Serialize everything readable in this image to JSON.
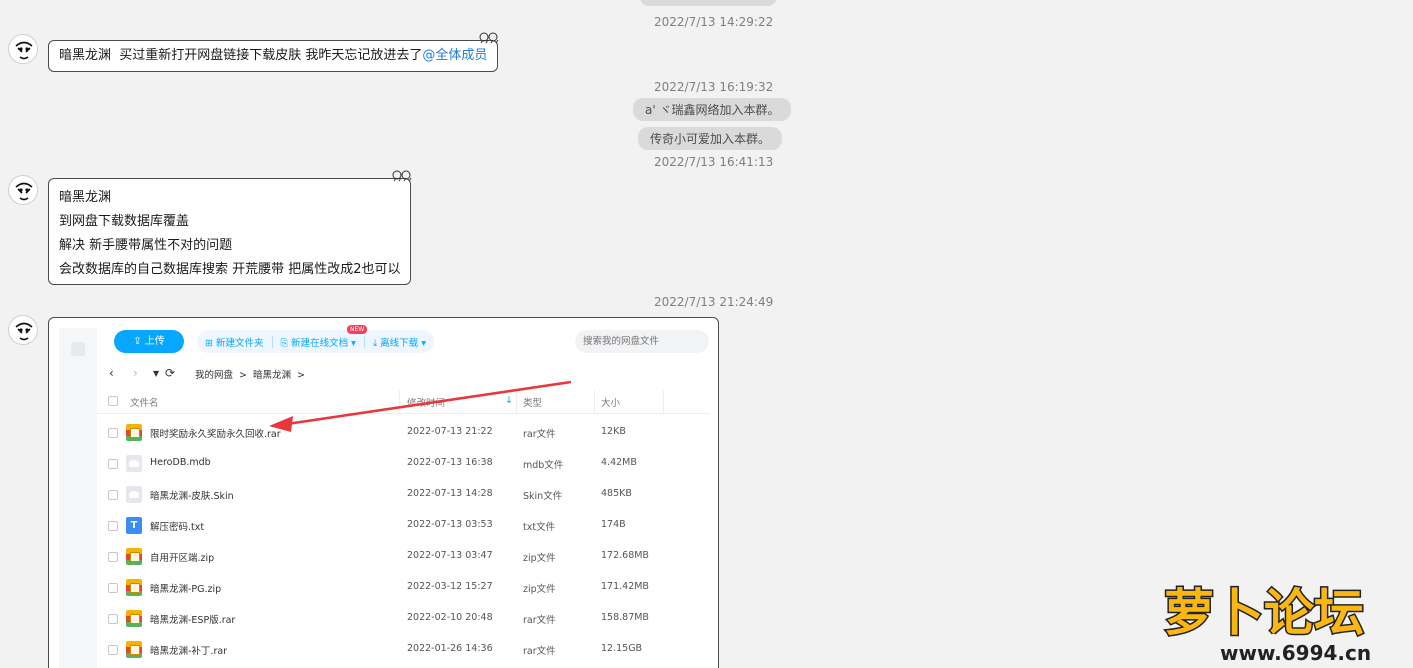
{
  "messages": {
    "top_pill": "...",
    "ts1": "2022/7/13 14:29:22",
    "msg1": {
      "sender": "暗黑龙渊",
      "text": "买过重新打开网盘链接下载皮肤 我昨天忘记放进去了",
      "mention": "@全体成员"
    },
    "ts2": "2022/7/13 16:19:32",
    "sys1": "a' ヾ瑞鑫网络加入本群。",
    "sys2": "传奇小可爱加入本群。",
    "ts3": "2022/7/13 16:41:13",
    "msg2": {
      "sender": "暗黑龙渊",
      "lines": [
        "到网盘下载数据库覆盖",
        "解决 新手腰带属性不对的问题",
        "会改数据库的自己数据库搜索 开荒腰带 把属性改成2也可以"
      ]
    },
    "ts4": "2022/7/13 21:24:49"
  },
  "netdisk": {
    "upload": "上传",
    "new_folder": "新建文件夹",
    "new_online_doc": "新建在线文档",
    "new_badge": "NEW",
    "offline_download": "离线下载",
    "search_placeholder": "搜索我的网盘文件",
    "breadcrumb": [
      "我的网盘",
      ">",
      "暗黑龙渊",
      ">"
    ],
    "columns": {
      "name": "文件名",
      "modified": "修改时间",
      "type": "类型",
      "size": "大小"
    },
    "files": [
      {
        "name": "限时奖励永久奖励永久回收.rar",
        "date": "2022-07-13 21:22",
        "type": "rar文件",
        "size": "12KB",
        "icon": "rar"
      },
      {
        "name": "HeroDB.mdb",
        "date": "2022-07-13 16:38",
        "type": "mdb文件",
        "size": "4.42MB",
        "icon": "doc"
      },
      {
        "name": "暗黑龙渊-皮肤.Skin",
        "date": "2022-07-13 14:28",
        "type": "Skin文件",
        "size": "485KB",
        "icon": "doc"
      },
      {
        "name": "解压密码.txt",
        "date": "2022-07-13 03:53",
        "type": "txt文件",
        "size": "174B",
        "icon": "txt"
      },
      {
        "name": "自用开区端.zip",
        "date": "2022-07-13 03:47",
        "type": "zip文件",
        "size": "172.68MB",
        "icon": "rar"
      },
      {
        "name": "暗黑龙渊-PG.zip",
        "date": "2022-03-12 15:27",
        "type": "zip文件",
        "size": "171.42MB",
        "icon": "rar"
      },
      {
        "name": "暗黑龙渊-ESP版.rar",
        "date": "2022-02-10 20:48",
        "type": "rar文件",
        "size": "158.87MB",
        "icon": "rar"
      },
      {
        "name": "暗黑龙渊-补丁.rar",
        "date": "2022-01-26 14:36",
        "type": "rar文件",
        "size": "12.15GB",
        "icon": "rar"
      }
    ]
  },
  "watermark": {
    "logo_text": "萝卜论坛",
    "url": "www.6994.cn"
  },
  "colors": {
    "upload_blue": "#06a7ff",
    "mention_blue": "#1e7bd6",
    "arrow_red": "#e8373d"
  }
}
